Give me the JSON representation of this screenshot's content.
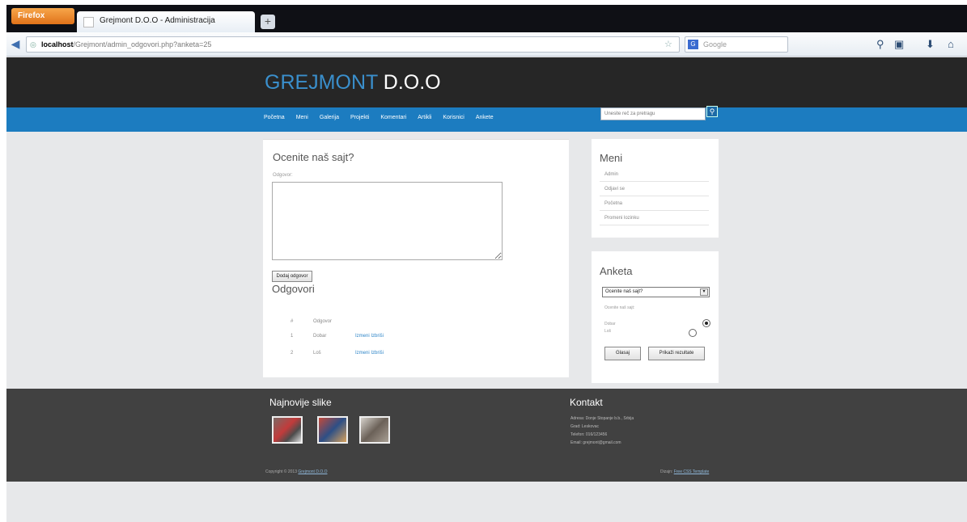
{
  "browser": {
    "app_button": "Firefox",
    "tab_title": "Grejmont D.O.O - Administracija",
    "new_tab": "+",
    "url_host": "localhost",
    "url_path": "/Grejmont/admin_odgovori.php?anketa=25",
    "search_placeholder": "Google",
    "search_engine_icon": "G",
    "icons": [
      "back-arrow-icon",
      "site-identity-icon",
      "star-icon",
      "reload-icon",
      "search-icon",
      "page-icon",
      "download-icon",
      "home-icon"
    ]
  },
  "site": {
    "title_part1": "GREJMONT",
    "title_part2": "D.O.O",
    "menu": [
      "Početna",
      "Meni",
      "Galerija",
      "Projekti",
      "Komentari",
      "Artikli",
      "Korisnici",
      "Ankete"
    ],
    "search_placeholder": "Unesite reč za pretragu"
  },
  "main": {
    "question": "Ocenite naš sajt?",
    "answer_label": "Odgovor:",
    "add_answer_button": "Dodaj odgovor",
    "answers_title": "Odgovori",
    "answers_header": {
      "id": "#",
      "text": "Odgovor"
    },
    "answers": [
      {
        "id": "1",
        "text": "Dobar",
        "actions": "Izmeni Izbriši"
      },
      {
        "id": "2",
        "text": "Loš",
        "actions": "Izmeni Izbriši"
      }
    ]
  },
  "sidebar": {
    "menu_title": "Meni",
    "menu_items": [
      "Admin",
      "Odjavi se",
      "Početna",
      "Promeni lozinku"
    ],
    "poll_title": "Anketa",
    "poll_select_value": "Ocenite naš sajt?",
    "poll_question": "Ocenite naš sajt:",
    "poll_options": [
      {
        "label": "Dobar",
        "checked": true
      },
      {
        "label": "Loš",
        "checked": false
      }
    ],
    "vote_button": "Glasaj",
    "results_button": "Prikaži rezultate"
  },
  "footer": {
    "recent_title": "Najnovije slike",
    "contact_title": "Kontakt",
    "contact_lines": [
      "Adresa: Donje Stopanje b.b., Srbija",
      "Grad: Leskovac",
      "Telefon: 016/123456",
      "Email: grejmont@gmail.com"
    ],
    "copyright_text": "Copyright © 2013",
    "copyright_link": "Grejmont D.O.O",
    "design_text": "Dizajn:",
    "design_link": "Free CSS Template"
  },
  "colors": {
    "accent_blue": "#1c7cc0",
    "title_blue": "#3a8fcc",
    "header_bg": "#262626",
    "footer_bg": "#414141",
    "page_bg": "#e7e8ea"
  }
}
